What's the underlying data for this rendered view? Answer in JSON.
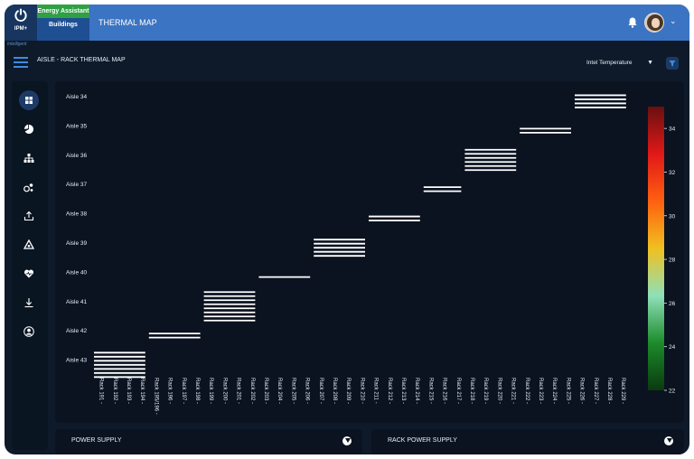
{
  "header": {
    "logo_text": "IPM+",
    "logo_sub": "Intelligent",
    "tag_energy": "Energy Assistant",
    "tag_buildings": "Buildings",
    "app_title": "THERMAL MAP"
  },
  "subheader": {
    "page_title": "AISLE - RACK THERMAL MAP",
    "metric_select": "Intel Temperature"
  },
  "sidebar": {
    "items": [
      {
        "icon": "dashboard-icon",
        "active": true
      },
      {
        "icon": "pie-chart-icon",
        "active": false
      },
      {
        "icon": "hierarchy-icon",
        "active": false
      },
      {
        "icon": "assets-icon",
        "active": false
      },
      {
        "icon": "upload-icon",
        "active": false
      },
      {
        "icon": "recycle-icon",
        "active": false
      },
      {
        "icon": "heart-icon",
        "active": false
      },
      {
        "icon": "download-icon",
        "active": false
      },
      {
        "icon": "user-icon",
        "active": false
      }
    ]
  },
  "chart_data": {
    "type": "heatmap",
    "y_categories": [
      "Aisle 34",
      "Aisle 35",
      "Aisle 36",
      "Aisle 37",
      "Aisle 38",
      "Aisle 39",
      "Aisle 40",
      "Aisle 41",
      "Aisle 42",
      "Aisle 43"
    ],
    "x_categories": [
      "Rack 191 -",
      "Rack 192 -",
      "Rack 193 -",
      "Rack 194 -",
      "Rack 195/196 -",
      "Rack 196 -",
      "Rack 197 -",
      "Rack 198 -",
      "Rack 199 -",
      "Rack 200 -",
      "Rack 201 -",
      "Rack 202 -",
      "Rack 203 -",
      "Rack 204 -",
      "Rack 205 -",
      "Rack 206 -",
      "Rack 207 -",
      "Rack 208 -",
      "Rack 209 -",
      "Rack 210 -",
      "Rack 211 -",
      "Rack 212 -",
      "Rack 213 -",
      "Rack 214 -",
      "Rack 215 -",
      "Rack 216 -",
      "Rack 217 -",
      "Rack 218 -",
      "Rack 219 -",
      "Rack 220 -",
      "Rack 221 -",
      "Rack 222 -",
      "Rack 223 -",
      "Rack 224 -",
      "Rack 225 -",
      "Rack 226 -",
      "Rack 227 -",
      "Rack 228 -",
      "Rack 229 -"
    ],
    "groups": [
      {
        "aisle": "Aisle 43",
        "rack_start": 0,
        "rack_end": 3,
        "lines": 7
      },
      {
        "aisle": "Aisle 42",
        "rack_start": 4,
        "rack_end": 7,
        "lines": 2
      },
      {
        "aisle": "Aisle 41",
        "rack_start": 8,
        "rack_end": 11,
        "lines": 8
      },
      {
        "aisle": "Aisle 40",
        "rack_start": 12,
        "rack_end": 15,
        "lines": 1
      },
      {
        "aisle": "Aisle 39",
        "rack_start": 16,
        "rack_end": 19,
        "lines": 5
      },
      {
        "aisle": "Aisle 38",
        "rack_start": 20,
        "rack_end": 23,
        "lines": 2
      },
      {
        "aisle": "Aisle 37",
        "rack_start": 24,
        "rack_end": 26,
        "lines": 2
      },
      {
        "aisle": "Aisle 36",
        "rack_start": 27,
        "rack_end": 30,
        "lines": 6
      },
      {
        "aisle": "Aisle 35",
        "rack_start": 31,
        "rack_end": 34,
        "lines": 2
      },
      {
        "aisle": "Aisle 34",
        "rack_start": 35,
        "rack_end": 38,
        "lines": 4
      }
    ],
    "colorbar": {
      "min": 22,
      "max": 35,
      "ticks": [
        34,
        32,
        30,
        28,
        26,
        24,
        22
      ],
      "colors": [
        "#0a3a10",
        "#1c8b2a",
        "#8fe0b8",
        "#f0c020",
        "#ff6010",
        "#e01818",
        "#6a1010"
      ]
    }
  },
  "panels": {
    "power_supply": "POWER SUPPLY",
    "rack_power_supply": "RACK POWER SUPPLY"
  }
}
